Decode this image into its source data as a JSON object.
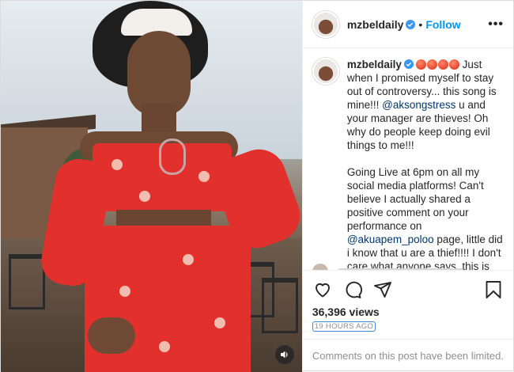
{
  "post": {
    "username": "mzbeldaily",
    "follow_label": "Follow",
    "separator": "•",
    "more_label": "•••",
    "caption": {
      "username": "mzbeldaily",
      "intro": "Just when I promised myself to stay out of controversy... this song is mine!!!",
      "mention1": "@aksongstress",
      "p1_rest": " u and your manager are thieves! Oh why do people keep doing evil things to me!!!",
      "p2_start": "Going Live at 6pm on all my social media platforms! Can't believe I actually shared a positive comment on your performance on",
      "mention2": "@akuapem_poloo",
      "p2_rest": " page, little did i know that u are a thief!!!! I don't care what anyone says, this is my intellectual property! My lawyer's are ready to take u people on!!!!!!!"
    },
    "time_ago": "19h",
    "views": "36,396 views",
    "timestamp": "19 HOURS AGO",
    "comments_limited": "Comments on this post have been limited.",
    "icons": {
      "like": "heart-icon",
      "comment": "comment-icon",
      "share": "send-icon",
      "save": "bookmark-icon",
      "sound": "speaker-icon",
      "verified": "verified-badge-icon"
    },
    "colors": {
      "accent": "#0095f6",
      "verified": "#3897f0",
      "timestamp_focus": "#3c8be0"
    }
  }
}
